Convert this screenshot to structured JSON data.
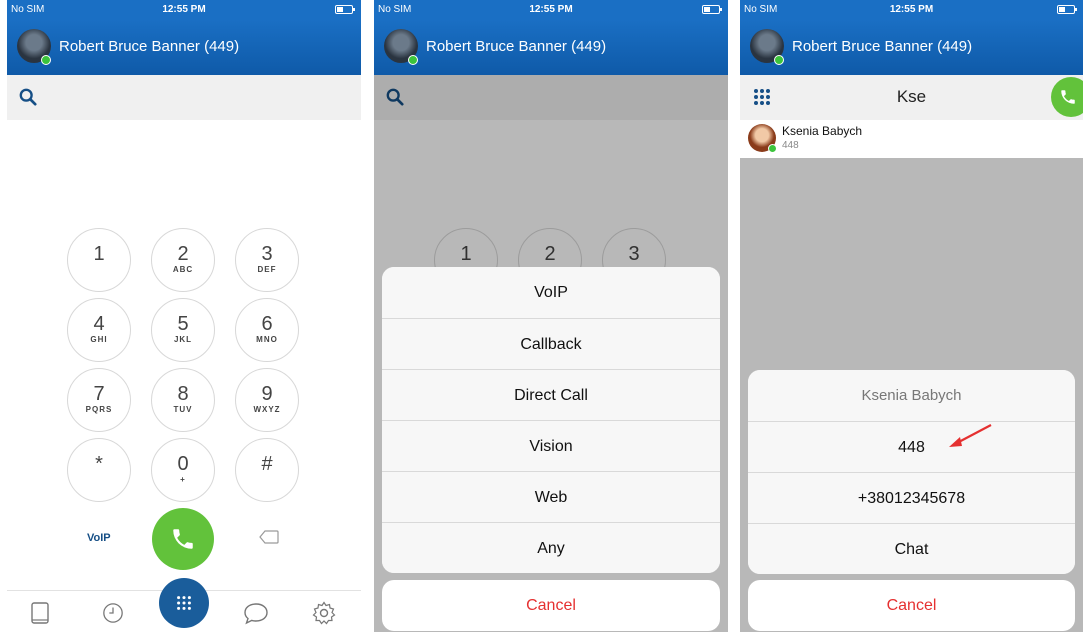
{
  "status": {
    "carrier": "No SIM",
    "time": "12:55 PM"
  },
  "user": {
    "name": "Robert Bruce Banner (449)"
  },
  "colors": {
    "brand": "#1a6fc4",
    "call_green": "#62c23b",
    "cancel_red": "#e53030",
    "fab": "#1a5d9b"
  },
  "dialer": {
    "keys": [
      {
        "digit": "1",
        "letters": ""
      },
      {
        "digit": "2",
        "letters": "ABC"
      },
      {
        "digit": "3",
        "letters": "DEF"
      },
      {
        "digit": "4",
        "letters": "GHI"
      },
      {
        "digit": "5",
        "letters": "JKL"
      },
      {
        "digit": "6",
        "letters": "MNO"
      },
      {
        "digit": "7",
        "letters": "PQRS"
      },
      {
        "digit": "8",
        "letters": "TUV"
      },
      {
        "digit": "9",
        "letters": "WXYZ"
      },
      {
        "digit": "*",
        "letters": ""
      },
      {
        "digit": "0",
        "letters": "+"
      },
      {
        "digit": "#",
        "letters": ""
      }
    ],
    "mode_label": "VoIP"
  },
  "call_type_sheet": {
    "options": [
      "VoIP",
      "Callback",
      "Direct Call",
      "Vision",
      "Web",
      "Any"
    ],
    "cancel": "Cancel"
  },
  "search_screen": {
    "query": "Kse",
    "result": {
      "name": "Ksenia Babych",
      "number": "448"
    }
  },
  "contact_sheet": {
    "title": "Ksenia Babych",
    "options": [
      "448",
      "+38012345678",
      "Chat"
    ],
    "cancel": "Cancel"
  },
  "icons": {
    "search": "search-icon",
    "call": "phone-icon",
    "backspace": "backspace-icon",
    "contacts": "contacts-book-icon",
    "recents": "clock-icon",
    "dialpad": "dialpad-icon",
    "chat": "chat-bubble-icon",
    "settings": "gear-icon"
  }
}
